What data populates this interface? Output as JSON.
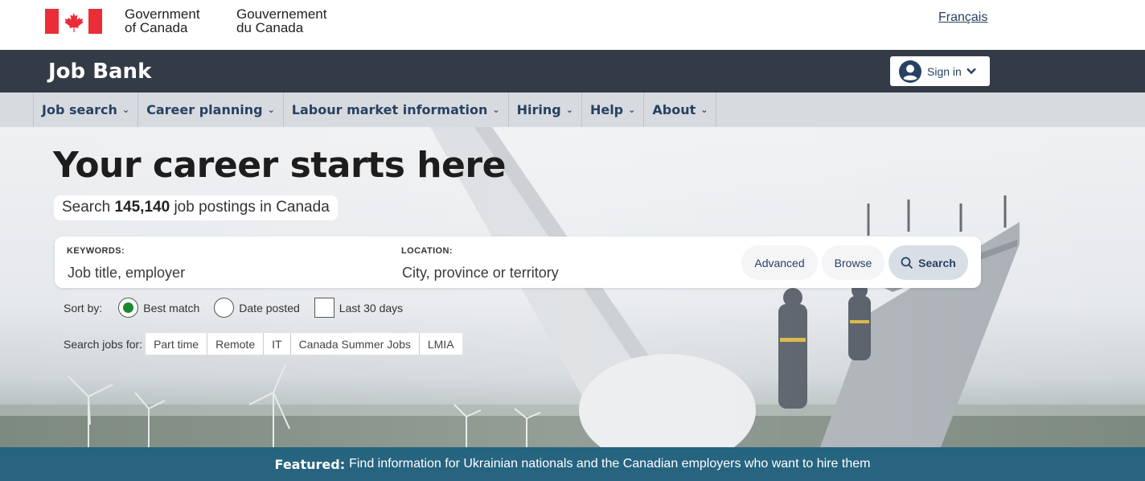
{
  "gov": {
    "en_line1": "Government",
    "en_line2": "of Canada",
    "fr_line1": "Gouvernement",
    "fr_line2": "du Canada",
    "language_toggle": "Français"
  },
  "app": {
    "title": "Job Bank",
    "signin_label": "Sign in"
  },
  "nav": {
    "items": [
      {
        "label": "Job search"
      },
      {
        "label": "Career planning"
      },
      {
        "label": "Labour market information"
      },
      {
        "label": "Hiring"
      },
      {
        "label": "Help"
      },
      {
        "label": "About"
      }
    ]
  },
  "hero": {
    "heading": "Your career starts here",
    "count_prefix": "Search",
    "count_value": "145,140",
    "count_suffix": "job postings in Canada"
  },
  "search": {
    "keywords_label": "KEYWORDS:",
    "keywords_placeholder": "Job title, employer",
    "location_label": "LOCATION:",
    "location_placeholder": "City, province or territory",
    "advanced_label": "Advanced",
    "browse_label": "Browse",
    "search_label": "Search"
  },
  "sort": {
    "label": "Sort by:",
    "best_match": "Best match",
    "date_posted": "Date posted",
    "last_30_days": "Last 30 days",
    "selected": "Best match",
    "last_30_checked": false
  },
  "quick_search": {
    "label": "Search jobs for:",
    "links": [
      "Part time",
      "Remote",
      "IT",
      "Canada Summer Jobs",
      "LMIA"
    ]
  },
  "featured": {
    "label": "Featured:",
    "text": "Find information for Ukrainian nationals and the Canadian employers who want to hire them"
  },
  "colors": {
    "flag_red": "#eb2d37",
    "app_bar": "#333b47",
    "nav_bg": "#d7dbe0",
    "link": "#284162",
    "featured_bg": "#26647f",
    "radio_selected": "#1a8a2f"
  },
  "icons": {
    "signin": "user-circle-icon",
    "signin_chevron": "chevron-down-icon",
    "search": "magnifier-icon"
  }
}
